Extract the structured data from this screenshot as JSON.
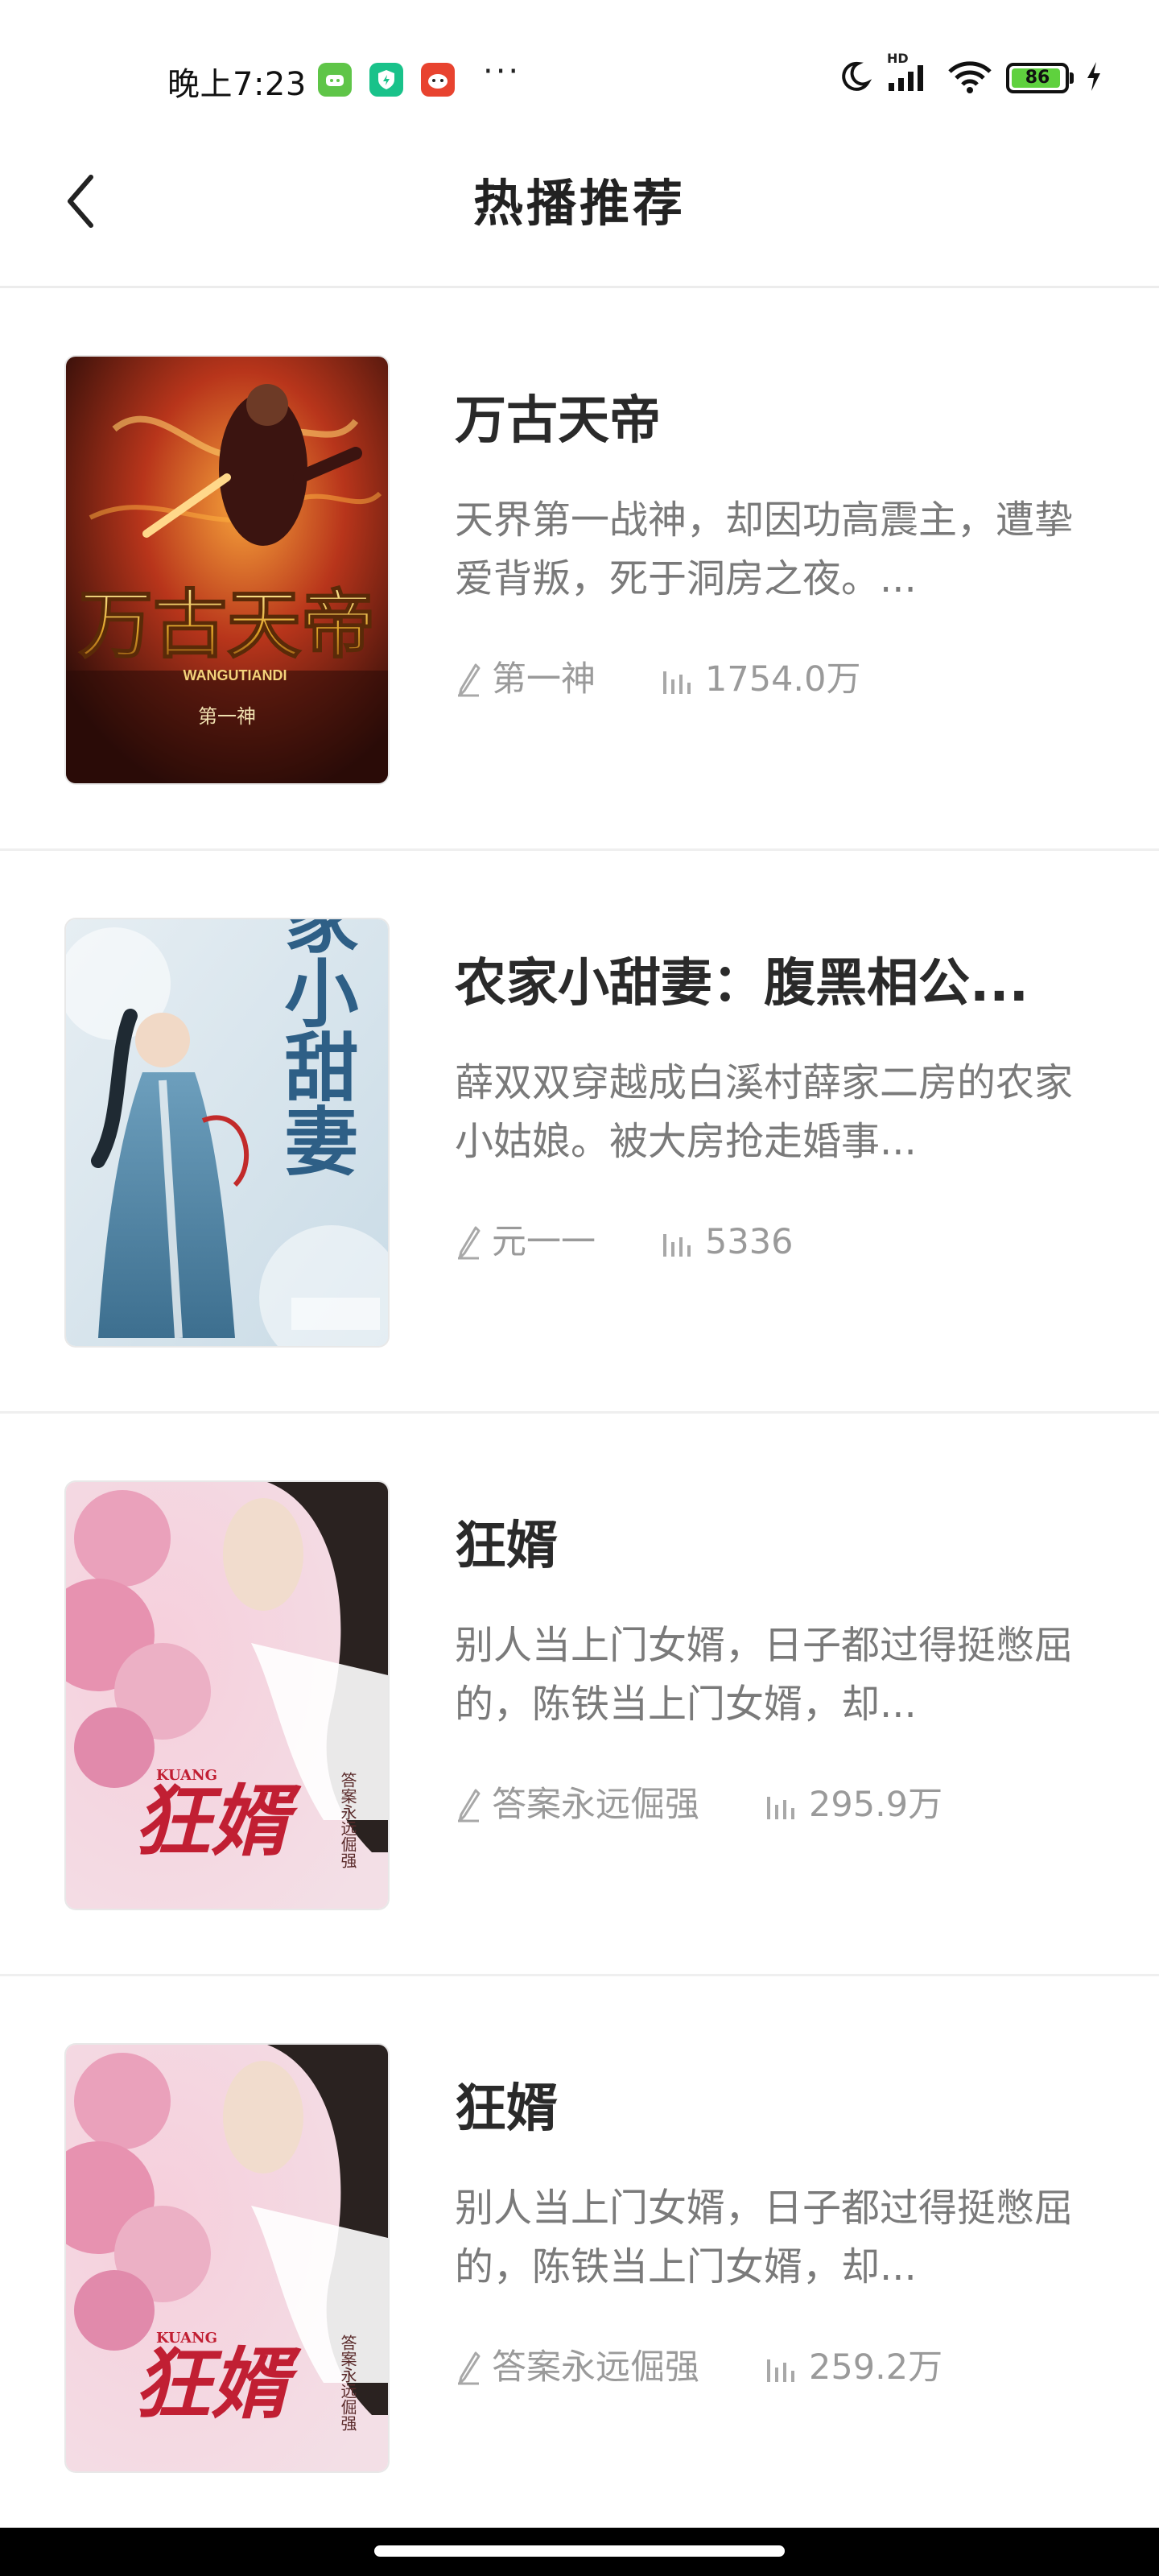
{
  "status_bar": {
    "time": "晚上7:23",
    "dots": "···",
    "battery_level": "86",
    "network": "HD"
  },
  "header": {
    "title": "热播推荐"
  },
  "books": [
    {
      "title": "万古天帝",
      "description": "天界第一战神，却因功高震主，遭挚爱背叛，死于洞房之夜。...",
      "author": "第一神",
      "reads": "1754.0万",
      "cover": {
        "title_text": "万古天帝",
        "subtitle": "WANGUTIANDI",
        "author_text": "第一神"
      }
    },
    {
      "title": "农家小甜妻：腹黑相公...",
      "description": "薛双双穿越成白溪村薛家二房的农家小姑娘。被大房抢走婚事...",
      "author": "元一一",
      "reads": "5336",
      "cover": {
        "title_text": "农家小甜妻"
      }
    },
    {
      "title": "狂婿",
      "description": "别人当上门女婿，日子都过得挺憋屈的，陈铁当上门女婿，却...",
      "author": "答案永远倔强",
      "reads": "295.9万",
      "cover": {
        "title_text": "狂婿",
        "subtitle": "KUANG",
        "author_text": "答案永远倔强"
      }
    },
    {
      "title": "狂婿",
      "description": "别人当上门女婿，日子都过得挺憋屈的，陈铁当上门女婿，却...",
      "author": "答案永远倔强",
      "reads": "259.2万",
      "cover": {
        "title_text": "狂婿",
        "subtitle": "KUANG",
        "author_text": "答案永远倔强"
      }
    }
  ],
  "icons": {
    "author": "pen-icon",
    "reads": "bar-chart-icon",
    "back": "chevron-left-icon"
  }
}
